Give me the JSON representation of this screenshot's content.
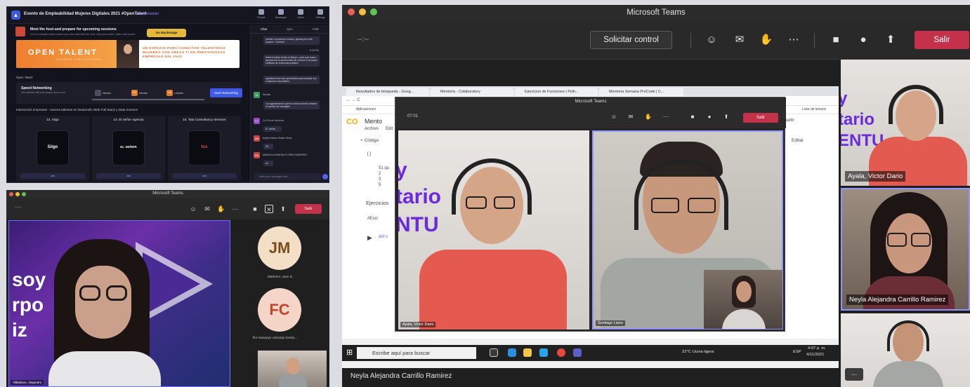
{
  "hopin": {
    "event_title": "Evento de Empleabilidad Mujeres Digitales 2021 #OpenTalent",
    "view_schedule": "View Schedule",
    "nav": [
      "People",
      "Messages",
      "Alerts",
      "Settings"
    ],
    "host_title": "Meet the host and prepare for upcoming sessions",
    "host_sub": "Go to a private space where you can chat with the host, test your audio, video and screen connection.",
    "backstage": "Go Backstage",
    "banner_title": "OPEN TALENT",
    "banner_sub": "MUJERES DIGITALES 2021",
    "banner_desc": "UN ESPACIO PARA CONECTAR TALENTOSAS MUJERES CON ÁREAS TI DE PRESTIGIOSAS EMPRESAS DEL PAÍS",
    "open_talent_label": "Open Talent",
    "speed_title": "Speed Networking",
    "speed_sub": "Get matched with new people one-on-one",
    "speed_nodes": [
      {
        "initials": "",
        "name": "Nicolás"
      },
      {
        "initials": "NC",
        "name": "Nicolás"
      },
      {
        "initials": "LM",
        "name": "Ludwick"
      }
    ],
    "start_networking": "Start Networking",
    "intersection_title": "Interacción empresas - nuevos talentos en Desarrollo Web Full Stack y Data Science",
    "booths": [
      {
        "title": "13. Siigo",
        "logo": "Siigo",
        "join": "Join"
      },
      {
        "title": "14. El Señor Agencia",
        "logo": "EL SEÑOR",
        "join": "Join"
      },
      {
        "title": "15. Tata Consultancy Services",
        "logo": "tcs",
        "join": "Join"
      }
    ],
    "chat_tabs": [
      "Chat",
      "Q&A",
      "Polls"
    ],
    "chat_messages": [
      {
        "text": "pueden conocerlos a todos, gracias por este espacio. Chévere!",
        "time": ""
      },
      {
        "text": "Aún el tiempo",
        "time": "5:23 PM"
      },
      {
        "text": "debería haber tenido el tiempo, pues qué bueno aprovechar la oportunidad de conocer a la mayor cantidad de empresas posibles",
        "time": ""
      },
      {
        "text": "agradecemos esta oportunidad para ampliar sus contactos corporativos",
        "time": ""
      },
      {
        "text": "Los agradecemos que en este momento mostrar el cambio de mensajes",
        "time": ""
      }
    ],
    "chat_users": [
      {
        "initials": "N",
        "name": "Nicolás",
        "color": "#3c9b5f"
      },
      {
        "initials": "CC",
        "name": "Co-Pro de Servicios",
        "color": "#8e4cc5"
      },
      {
        "initials": "AM",
        "name": "Angela María Giraldo Mesa",
        "color": "#c14646"
      },
      {
        "initials": "MA",
        "name": "MARIA ALEJANDRA FLOREZ BARRERO",
        "color": "#c14646"
      }
    ],
    "chat_short": [
      "Sí, llenas",
      "Ok",
      "ok"
    ],
    "chat_placeholder": "Write your message here..."
  },
  "teams_small": {
    "title": "Microsoft Teams",
    "time": "--:--",
    "leave": "Salir",
    "video_words": [
      "soy",
      "rpo",
      "iz"
    ],
    "main_name": "Villalobos, Alejandro",
    "participants": [
      {
        "initials": "JM",
        "name": "Martínez, Juan D.",
        "bg": "#f3dfc6",
        "fg": "#7a4d1c"
      },
      {
        "initials": "FC",
        "name": "flor sampayo camargo (Invita...",
        "bg": "#f5d5c8",
        "fg": "#c4452b"
      }
    ]
  },
  "teams_big": {
    "title": "Microsoft Teams",
    "time": "--:--",
    "request_control": "Solicitar control",
    "leave": "Salir",
    "browser_tabs": [
      "Resultados de búsqueda - Goog...",
      "Mentoría - Colaboratory",
      "Ejercicios de Funciones | Pyth...",
      "Mentoría Semana ProCode | C..."
    ],
    "bookmarks_apps": "Aplicaciones",
    "bookmarks_read": "Lista de lectura",
    "colab_title": "Mento",
    "colab_menu": [
      "Archivo",
      "Edit"
    ],
    "colab_code_btn": "+ Código",
    "colab_edit": "Editar",
    "colab_share": "partir",
    "code_lines": [
      "[ ]",
      "51 qu",
      "2",
      "3",
      "5"
    ],
    "exercise_label": "Ejercicios",
    "hash_escr": "#Escr",
    "def_kw": "def v",
    "inner_title": "Microsoft Teams",
    "inner_time": "07:01",
    "inner_leave": "Salir",
    "inner_v1_name": "Ayala, Victor Dario",
    "inner_v2_name": "Santiago Llano",
    "bg_words": [
      "y",
      "tario",
      "NTU"
    ],
    "search_placeholder": "Escribe aquí para buscar",
    "weather": "22°C Lluvia ligera",
    "tray_lang": "ESP",
    "clock_time": "4:07 p. m.",
    "clock_date": "4/11/2021",
    "side_videos": [
      {
        "name": "Ayala, Victor Dario"
      },
      {
        "name": "Neyla Alejandra Carrillo Ramirez"
      },
      {
        "name": ""
      }
    ],
    "side_bg_words": [
      "y",
      "tario",
      "ENTU"
    ],
    "bottom_name": "Neyla Alejandra Carrillo Ramirez",
    "more": "..."
  }
}
